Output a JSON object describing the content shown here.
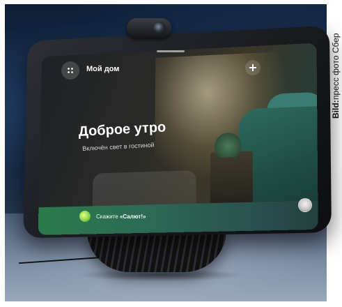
{
  "screen": {
    "home_title": "Мой дом",
    "greeting": "Доброе утро",
    "status": "Включён свет в гостиной",
    "assistant_prompt_prefix": "Скажите",
    "assistant_prompt_name": "«Салют!»"
  },
  "icons": {
    "home": "grid-dots-icon",
    "add": "plus-icon",
    "assistant": "assistant-orb-icon",
    "avatar": "user-avatar-icon"
  },
  "credit": {
    "label": "Bild:",
    "source": "пресс фото Сбер"
  },
  "colors": {
    "assistant_bar": "#2b7a4c",
    "screen_accent": "#2e6b5f"
  }
}
